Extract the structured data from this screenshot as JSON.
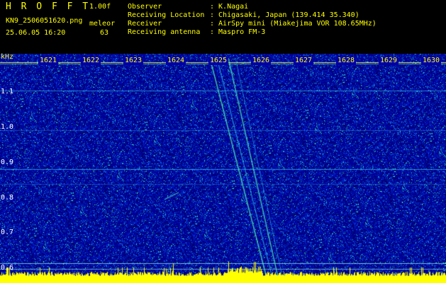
{
  "header": {
    "app_name": "H R O F F T",
    "version": "1.00f",
    "filename": "KN9_2506051620.png",
    "datetime": "25.06.05 16:20",
    "mode_label": "meleor",
    "count": "63"
  },
  "info": [
    {
      "label": "Observer",
      "value": ": K.Nagai"
    },
    {
      "label": "Receiving Location",
      "value": ": Chigasaki, Japan (139.414 35.340)"
    },
    {
      "label": "Receiver",
      "value": ": AirSpy mini (Miakejima VOR 108.65MHz)"
    },
    {
      "label": "Receiving antenna",
      "value": ": Maspro FM-3"
    }
  ],
  "axis": {
    "unit": "kHz",
    "y_ticks": [
      "1.1",
      "1.0",
      "0.9",
      "0.8",
      "0.7",
      "0.6"
    ],
    "x_ticks": [
      "1621",
      "1622",
      "1623",
      "1624",
      "1625",
      "1626",
      "1627",
      "1628",
      "1629",
      "1630"
    ]
  },
  "colors": {
    "background": "#000000",
    "plot_bg": "#0000a8",
    "text_yellow": "#ffff00",
    "text_white": "#ffffff",
    "signal": "#40ffa0"
  }
}
